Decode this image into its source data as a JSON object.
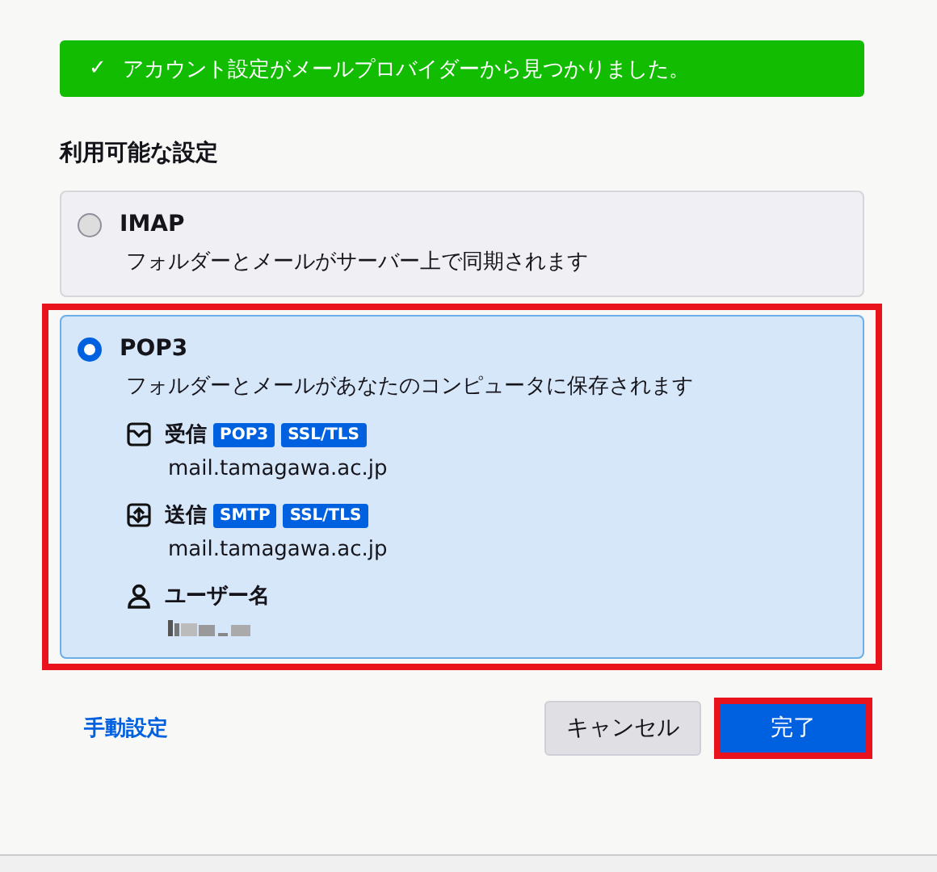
{
  "banner": {
    "text": "アカウント設定がメールプロバイダーから見つかりました。",
    "icon": "✓"
  },
  "heading": "利用可能な設定",
  "options": [
    {
      "name": "IMAP",
      "description": "フォルダーとメールがサーバー上で同期されます",
      "selected": false,
      "highlighted": false
    },
    {
      "name": "POP3",
      "description": "フォルダーとメールがあなたのコンピュータに保存されます",
      "selected": true,
      "highlighted": true,
      "details": [
        {
          "kind": "incoming",
          "label": "受信",
          "tags": [
            "POP3",
            "SSL/TLS"
          ],
          "value": "mail.tamagawa.ac.jp"
        },
        {
          "kind": "outgoing",
          "label": "送信",
          "tags": [
            "SMTP",
            "SSL/TLS"
          ],
          "value": "mail.tamagawa.ac.jp"
        },
        {
          "kind": "user",
          "label": "ユーザー名",
          "redacted": true
        }
      ]
    }
  ],
  "manual_link": "手動設定",
  "buttons": [
    {
      "label": "キャンセル",
      "kind": "secondary",
      "highlighted": false
    },
    {
      "label": "完了",
      "kind": "primary",
      "highlighted": true
    }
  ]
}
